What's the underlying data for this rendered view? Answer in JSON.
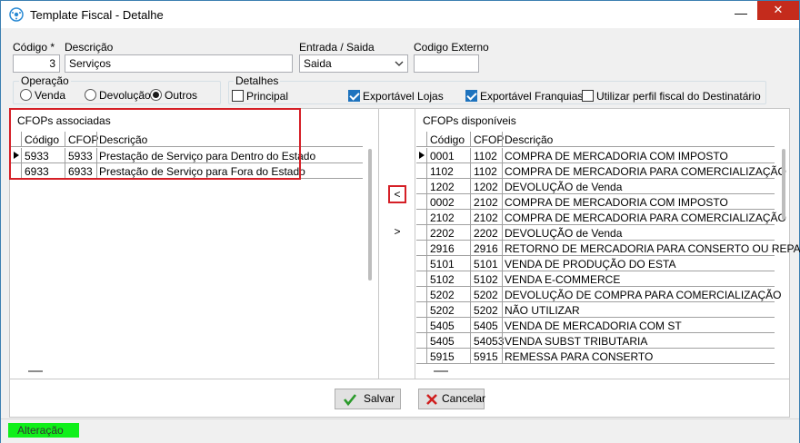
{
  "window": {
    "title": "Template Fiscal - Detalhe",
    "minimize_glyph": "—",
    "close_glyph": "✕"
  },
  "form": {
    "codigo_label": "Código *",
    "codigo_value": "3",
    "descricao_label": "Descrição",
    "descricao_value": "Serviços",
    "entrada_label": "Entrada / Saida",
    "entrada_value": "Saida",
    "codigo_externo_label": "Codigo Externo",
    "codigo_externo_value": ""
  },
  "operacao": {
    "title": "Operação",
    "options": [
      "Venda",
      "Devolução",
      "Outros"
    ],
    "selected": "Outros"
  },
  "detalhes": {
    "title": "Detalhes",
    "principal": "Principal",
    "exportavel_lojas": "Exportável Lojas",
    "exportavel_franquias": "Exportável Franquias",
    "utilizar_perfil": "Utilizar perfil fiscal do Destinatário"
  },
  "associadas": {
    "title": "CFOPs associadas",
    "headers": [
      "Código",
      "CFOP",
      "Descrição"
    ],
    "rows": [
      [
        "5933",
        "5933",
        "Prestação de Serviço para Dentro do Estado"
      ],
      [
        "6933",
        "6933",
        "Prestação de Serviço para Fora do Estado"
      ]
    ]
  },
  "disponiveis": {
    "title": "CFOPs disponíveis",
    "headers": [
      "Código",
      "CFOP",
      "Descrição"
    ],
    "rows": [
      [
        "0001",
        "1102",
        "COMPRA DE MERCADORIA COM IMPOSTO"
      ],
      [
        "1102",
        "1102",
        "COMPRA DE MERCADORIA PARA COMERCIALIZAÇÃO"
      ],
      [
        "1202",
        "1202",
        "DEVOLUÇÃO de Venda"
      ],
      [
        "0002",
        "2102",
        "COMPRA DE MERCADORIA COM IMPOSTO"
      ],
      [
        "2102",
        "2102",
        "COMPRA DE MERCADORIA PARA COMERCIALIZAÇÃO"
      ],
      [
        "2202",
        "2202",
        "DEVOLUÇÃO de Venda"
      ],
      [
        "2916",
        "2916",
        "RETORNO DE MERCADORIA PARA CONSERTO OU REPARO"
      ],
      [
        "5101",
        "5101",
        "VENDA DE PRODUÇÃO DO ESTA"
      ],
      [
        "5102",
        "5102",
        "VENDA E-COMMERCE"
      ],
      [
        "5202",
        "5202",
        "DEVOLUÇÃO DE COMPRA PARA COMERCIALIZAÇÃO"
      ],
      [
        "5202",
        "5202",
        "NÃO UTILIZAR"
      ],
      [
        "5405",
        "5405",
        "VENDA DE MERCADORIA COM ST"
      ],
      [
        "5405",
        "54053",
        "VENDA SUBST TRIBUTARIA"
      ],
      [
        "5915",
        "5915",
        "REMESSA PARA CONSERTO"
      ]
    ]
  },
  "transfer": {
    "add_label": "<",
    "remove_label": ">"
  },
  "buttons": {
    "salvar": "Salvar",
    "cancelar": "Cancelar"
  },
  "status": {
    "text": "Alteração"
  }
}
